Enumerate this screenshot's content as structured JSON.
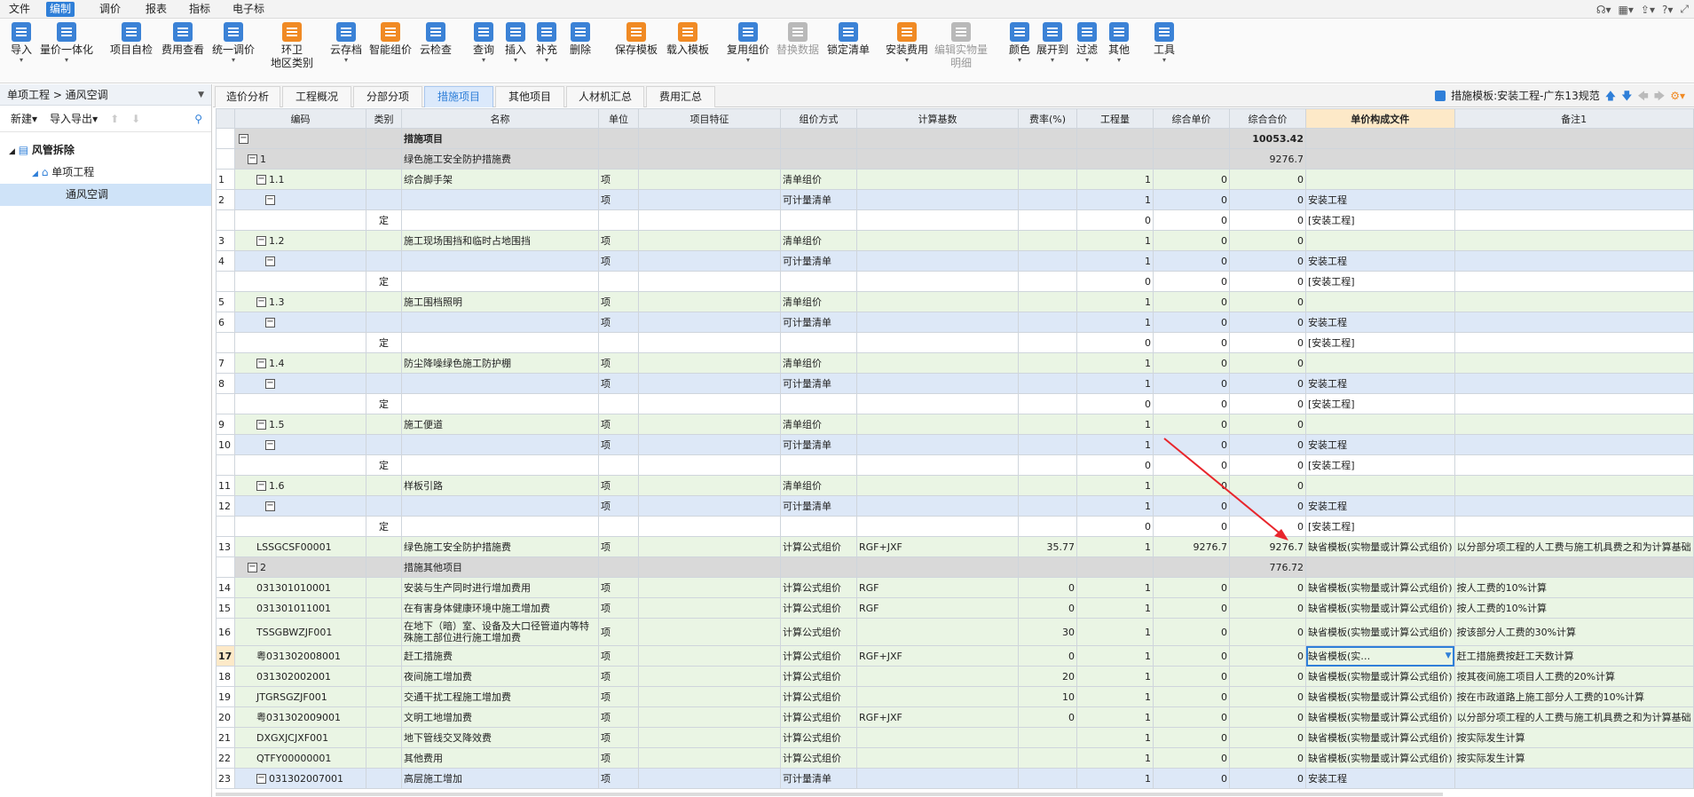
{
  "menu": [
    "文件",
    "编制",
    "调价",
    "报表",
    "指标",
    "电子标"
  ],
  "ribbon": [
    {
      "label": "导入",
      "icon": "import-icon"
    },
    {
      "label": "量价一体化",
      "icon": "integration-icon"
    },
    {
      "label": "项目自检",
      "icon": "self-check-icon"
    },
    {
      "label": "费用查看",
      "icon": "fee-view-icon"
    },
    {
      "label": "统一调价",
      "icon": "adjust-price-icon"
    },
    {
      "label": "环卫",
      "label2": "地区类别",
      "icon": "region-icon"
    },
    {
      "label": "云存档",
      "icon": "cloud-save-icon"
    },
    {
      "label": "智能组价",
      "icon": "smart-price-icon"
    },
    {
      "label": "云检查",
      "icon": "cloud-check-icon"
    },
    {
      "label": "查询",
      "icon": "query-icon"
    },
    {
      "label": "插入",
      "icon": "insert-icon"
    },
    {
      "label": "补充",
      "icon": "supplement-icon"
    },
    {
      "label": "删除",
      "icon": "delete-icon"
    },
    {
      "label": "保存模板",
      "icon": "save-template-icon"
    },
    {
      "label": "载入模板",
      "icon": "load-template-icon"
    },
    {
      "label": "复用组价",
      "icon": "reuse-icon"
    },
    {
      "label": "替换数据",
      "icon": "replace-icon"
    },
    {
      "label": "锁定清单",
      "icon": "lock-icon"
    },
    {
      "label": "安装费用",
      "icon": "install-fee-icon"
    },
    {
      "label": "编辑实物量",
      "label2": "明细",
      "icon": "edit-quantity-icon"
    },
    {
      "label": "颜色",
      "icon": "color-icon"
    },
    {
      "label": "展开到",
      "icon": "expand-icon"
    },
    {
      "label": "过滤",
      "icon": "filter-icon"
    },
    {
      "label": "其他",
      "icon": "other-icon"
    },
    {
      "label": "工具",
      "icon": "tools-icon"
    }
  ],
  "left": {
    "breadcrumb": "单项工程 > 通风空调",
    "new_label": "新建",
    "import_export_label": "导入导出",
    "tree": [
      "风管拆除",
      "单项工程",
      "通风空调"
    ]
  },
  "tabs": [
    "造价分析",
    "工程概况",
    "分部分项",
    "措施项目",
    "其他项目",
    "人材机汇总",
    "费用汇总"
  ],
  "template_label": "措施模板:安装工程-广东13规范",
  "columns": [
    "",
    "编码",
    "类别",
    "名称",
    "单位",
    "项目特征",
    "组价方式",
    "计算基数",
    "费率(%)",
    "工程量",
    "综合单价",
    "综合合价",
    "单价构成文件",
    "备注1"
  ],
  "rows": [
    {
      "t": "head",
      "rn": "",
      "code": "",
      "type": "",
      "name": "措施项目",
      "unit": "",
      "feat": "",
      "way": "",
      "base": "",
      "rate": "",
      "qty": "",
      "price": "",
      "total": "10053.42",
      "file": "",
      "note": "",
      "lvl": 0,
      "box": true,
      "bold": true
    },
    {
      "t": "head",
      "rn": "",
      "code": "1",
      "type": "",
      "name": "绿色施工安全防护措施费",
      "unit": "",
      "feat": "",
      "way": "",
      "base": "",
      "rate": "",
      "qty": "",
      "price": "",
      "total": "9276.7",
      "file": "",
      "note": "",
      "lvl": 1,
      "box": true
    },
    {
      "t": "grn",
      "rn": "1",
      "code": "1.1",
      "type": "",
      "name": "综合脚手架",
      "unit": "项",
      "feat": "",
      "way": "清单组价",
      "base": "",
      "rate": "",
      "qty": "1",
      "price": "0",
      "total": "0",
      "file": "",
      "note": "",
      "lvl": 2,
      "box": true
    },
    {
      "t": "blu",
      "rn": "2",
      "code": "",
      "type": "",
      "name": "",
      "unit": "项",
      "feat": "",
      "way": "可计量清单",
      "base": "",
      "rate": "",
      "qty": "1",
      "price": "0",
      "total": "0",
      "file": "安装工程",
      "note": "",
      "lvl": 3,
      "box": true
    },
    {
      "t": "wht",
      "rn": "",
      "code": "",
      "type": "定",
      "name": "",
      "unit": "",
      "feat": "",
      "way": "",
      "base": "",
      "rate": "",
      "qty": "0",
      "price": "0",
      "total": "0",
      "file": "[安装工程]",
      "note": "",
      "lvl": 4,
      "box": false
    },
    {
      "t": "grn",
      "rn": "3",
      "code": "1.2",
      "type": "",
      "name": "施工现场围挡和临时占地围挡",
      "unit": "项",
      "feat": "",
      "way": "清单组价",
      "base": "",
      "rate": "",
      "qty": "1",
      "price": "0",
      "total": "0",
      "file": "",
      "note": "",
      "lvl": 2,
      "box": true
    },
    {
      "t": "blu",
      "rn": "4",
      "code": "",
      "type": "",
      "name": "",
      "unit": "项",
      "feat": "",
      "way": "可计量清单",
      "base": "",
      "rate": "",
      "qty": "1",
      "price": "0",
      "total": "0",
      "file": "安装工程",
      "note": "",
      "lvl": 3,
      "box": true
    },
    {
      "t": "wht",
      "rn": "",
      "code": "",
      "type": "定",
      "name": "",
      "unit": "",
      "feat": "",
      "way": "",
      "base": "",
      "rate": "",
      "qty": "0",
      "price": "0",
      "total": "0",
      "file": "[安装工程]",
      "note": "",
      "lvl": 4,
      "box": false
    },
    {
      "t": "grn",
      "rn": "5",
      "code": "1.3",
      "type": "",
      "name": "施工围档照明",
      "unit": "项",
      "feat": "",
      "way": "清单组价",
      "base": "",
      "rate": "",
      "qty": "1",
      "price": "0",
      "total": "0",
      "file": "",
      "note": "",
      "lvl": 2,
      "box": true
    },
    {
      "t": "blu",
      "rn": "6",
      "code": "",
      "type": "",
      "name": "",
      "unit": "项",
      "feat": "",
      "way": "可计量清单",
      "base": "",
      "rate": "",
      "qty": "1",
      "price": "0",
      "total": "0",
      "file": "安装工程",
      "note": "",
      "lvl": 3,
      "box": true
    },
    {
      "t": "wht",
      "rn": "",
      "code": "",
      "type": "定",
      "name": "",
      "unit": "",
      "feat": "",
      "way": "",
      "base": "",
      "rate": "",
      "qty": "0",
      "price": "0",
      "total": "0",
      "file": "[安装工程]",
      "note": "",
      "lvl": 4,
      "box": false
    },
    {
      "t": "grn",
      "rn": "7",
      "code": "1.4",
      "type": "",
      "name": "防尘降噪绿色施工防护棚",
      "unit": "项",
      "feat": "",
      "way": "清单组价",
      "base": "",
      "rate": "",
      "qty": "1",
      "price": "0",
      "total": "0",
      "file": "",
      "note": "",
      "lvl": 2,
      "box": true
    },
    {
      "t": "blu",
      "rn": "8",
      "code": "",
      "type": "",
      "name": "",
      "unit": "项",
      "feat": "",
      "way": "可计量清单",
      "base": "",
      "rate": "",
      "qty": "1",
      "price": "0",
      "total": "0",
      "file": "安装工程",
      "note": "",
      "lvl": 3,
      "box": true
    },
    {
      "t": "wht",
      "rn": "",
      "code": "",
      "type": "定",
      "name": "",
      "unit": "",
      "feat": "",
      "way": "",
      "base": "",
      "rate": "",
      "qty": "0",
      "price": "0",
      "total": "0",
      "file": "[安装工程]",
      "note": "",
      "lvl": 4,
      "box": false
    },
    {
      "t": "grn",
      "rn": "9",
      "code": "1.5",
      "type": "",
      "name": "施工便道",
      "unit": "项",
      "feat": "",
      "way": "清单组价",
      "base": "",
      "rate": "",
      "qty": "1",
      "price": "0",
      "total": "0",
      "file": "",
      "note": "",
      "lvl": 2,
      "box": true
    },
    {
      "t": "blu",
      "rn": "10",
      "code": "",
      "type": "",
      "name": "",
      "unit": "项",
      "feat": "",
      "way": "可计量清单",
      "base": "",
      "rate": "",
      "qty": "1",
      "price": "0",
      "total": "0",
      "file": "安装工程",
      "note": "",
      "lvl": 3,
      "box": true
    },
    {
      "t": "wht",
      "rn": "",
      "code": "",
      "type": "定",
      "name": "",
      "unit": "",
      "feat": "",
      "way": "",
      "base": "",
      "rate": "",
      "qty": "0",
      "price": "0",
      "total": "0",
      "file": "[安装工程]",
      "note": "",
      "lvl": 4,
      "box": false
    },
    {
      "t": "grn",
      "rn": "11",
      "code": "1.6",
      "type": "",
      "name": "样板引路",
      "unit": "项",
      "feat": "",
      "way": "清单组价",
      "base": "",
      "rate": "",
      "qty": "1",
      "price": "0",
      "total": "0",
      "file": "",
      "note": "",
      "lvl": 2,
      "box": true
    },
    {
      "t": "blu",
      "rn": "12",
      "code": "",
      "type": "",
      "name": "",
      "unit": "项",
      "feat": "",
      "way": "可计量清单",
      "base": "",
      "rate": "",
      "qty": "1",
      "price": "0",
      "total": "0",
      "file": "安装工程",
      "note": "",
      "lvl": 3,
      "box": true
    },
    {
      "t": "wht",
      "rn": "",
      "code": "",
      "type": "定",
      "name": "",
      "unit": "",
      "feat": "",
      "way": "",
      "base": "",
      "rate": "",
      "qty": "0",
      "price": "0",
      "total": "0",
      "file": "[安装工程]",
      "note": "",
      "lvl": 4,
      "box": false
    },
    {
      "t": "grn",
      "rn": "13",
      "code": "LSSGCSF00001",
      "type": "",
      "name": "绿色施工安全防护措施费",
      "unit": "项",
      "feat": "",
      "way": "计算公式组价",
      "base": "RGF+JXF",
      "rate": "35.77",
      "qty": "1",
      "price": "9276.7",
      "total": "9276.7",
      "file": "缺省模板(实物量或计算公式组价)",
      "note": "以分部分项工程的人工费与施工机具费之和为计算基础",
      "lvl": 2,
      "box": false
    },
    {
      "t": "head",
      "rn": "",
      "code": "2",
      "type": "",
      "name": "措施其他项目",
      "unit": "",
      "feat": "",
      "way": "",
      "base": "",
      "rate": "",
      "qty": "",
      "price": "",
      "total": "776.72",
      "file": "",
      "note": "",
      "lvl": 1,
      "box": true
    },
    {
      "t": "grn",
      "rn": "14",
      "code": "031301010001",
      "type": "",
      "name": "安装与生产同时进行增加费用",
      "unit": "项",
      "feat": "",
      "way": "计算公式组价",
      "base": "RGF",
      "rate": "0",
      "qty": "1",
      "price": "0",
      "total": "0",
      "file": "缺省模板(实物量或计算公式组价)",
      "note": "按人工费的10%计算",
      "lvl": 2,
      "box": false
    },
    {
      "t": "grn",
      "rn": "15",
      "code": "031301011001",
      "type": "",
      "name": "在有害身体健康环境中施工增加费",
      "unit": "项",
      "feat": "",
      "way": "计算公式组价",
      "base": "RGF",
      "rate": "0",
      "qty": "1",
      "price": "0",
      "total": "0",
      "file": "缺省模板(实物量或计算公式组价)",
      "note": "按人工费的10%计算",
      "lvl": 2,
      "box": false
    },
    {
      "t": "grn",
      "rn": "16",
      "code": "TSSGBWZJF001",
      "type": "",
      "name": "在地下（暗）室、设备及大口径管道内等特殊施工部位进行施工增加费",
      "unit": "项",
      "feat": "",
      "way": "计算公式组价",
      "base": "",
      "rate": "30",
      "qty": "1",
      "price": "0",
      "total": "0",
      "file": "缺省模板(实物量或计算公式组价)",
      "note": "按该部分人工费的30%计算",
      "lvl": 2,
      "box": false,
      "tall": true
    },
    {
      "t": "grn",
      "rn": "17",
      "code": "粤031302008001",
      "type": "",
      "name": "赶工措施费",
      "unit": "项",
      "feat": "",
      "way": "计算公式组价",
      "base": "RGF+JXF",
      "rate": "0",
      "qty": "1",
      "price": "0",
      "total": "0",
      "file": "缺省模板(实物量或计算公式组价)",
      "note": "赶工措施费按赶工天数计算",
      "lvl": 2,
      "box": false,
      "cur": true
    },
    {
      "t": "grn",
      "rn": "18",
      "code": "031302002001",
      "type": "",
      "name": "夜间施工增加费",
      "unit": "项",
      "feat": "",
      "way": "计算公式组价",
      "base": "",
      "rate": "20",
      "qty": "1",
      "price": "0",
      "total": "0",
      "file": "缺省模板(实物量或计算公式组价)",
      "note": "按其夜间施工项目人工费的20%计算",
      "lvl": 2,
      "box": false
    },
    {
      "t": "grn",
      "rn": "19",
      "code": "JTGRSGZJF001",
      "type": "",
      "name": "交通干扰工程施工增加费",
      "unit": "项",
      "feat": "",
      "way": "计算公式组价",
      "base": "",
      "rate": "10",
      "qty": "1",
      "price": "0",
      "total": "0",
      "file": "缺省模板(实物量或计算公式组价)",
      "note": "按在市政道路上施工部分人工费的10%计算",
      "lvl": 2,
      "box": false
    },
    {
      "t": "grn",
      "rn": "20",
      "code": "粤031302009001",
      "type": "",
      "name": "文明工地增加费",
      "unit": "项",
      "feat": "",
      "way": "计算公式组价",
      "base": "RGF+JXF",
      "rate": "0",
      "qty": "1",
      "price": "0",
      "total": "0",
      "file": "缺省模板(实物量或计算公式组价)",
      "note": "以分部分项工程的人工费与施工机具费之和为计算基础",
      "lvl": 2,
      "box": false
    },
    {
      "t": "grn",
      "rn": "21",
      "code": "DXGXJCJXF001",
      "type": "",
      "name": "地下管线交叉降效费",
      "unit": "项",
      "feat": "",
      "way": "计算公式组价",
      "base": "",
      "rate": "",
      "qty": "1",
      "price": "0",
      "total": "0",
      "file": "缺省模板(实物量或计算公式组价)",
      "note": "按实际发生计算",
      "lvl": 2,
      "box": false
    },
    {
      "t": "grn",
      "rn": "22",
      "code": "QTFY00000001",
      "type": "",
      "name": "其他费用",
      "unit": "项",
      "feat": "",
      "way": "计算公式组价",
      "base": "",
      "rate": "",
      "qty": "1",
      "price": "0",
      "total": "0",
      "file": "缺省模板(实物量或计算公式组价)",
      "note": "按实际发生计算",
      "lvl": 2,
      "box": false
    },
    {
      "t": "blu",
      "rn": "23",
      "code": "031302007001",
      "type": "",
      "name": "高层施工增加",
      "unit": "项",
      "feat": "",
      "way": "可计量清单",
      "base": "",
      "rate": "",
      "qty": "1",
      "price": "0",
      "total": "0",
      "file": "安装工程",
      "note": "",
      "lvl": 2,
      "box": true
    }
  ],
  "colors": {
    "accent": "#2f7fd8",
    "row_green": "#eaf5e4",
    "row_blue": "#dde8f7",
    "row_head": "#d9d9d9",
    "arrow": "#e8262c"
  }
}
